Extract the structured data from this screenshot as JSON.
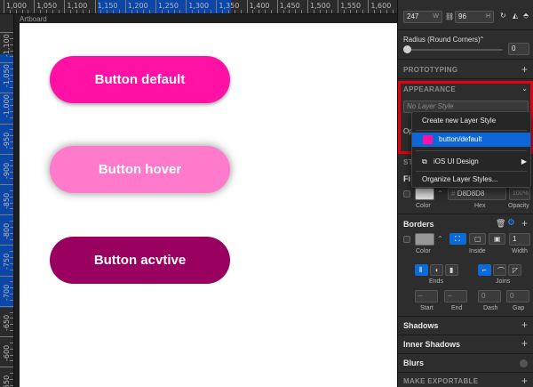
{
  "rulers": {
    "top": [
      "1,000",
      "1,050",
      "1,100",
      "1,150",
      "1,200",
      "1,250",
      "1,300",
      "1,350",
      "1,400",
      "1,450",
      "1,500",
      "1,550",
      "1,600"
    ],
    "left": [
      "-1,100",
      "-1,050",
      "-1,000",
      "-950",
      "-900",
      "-850",
      "-800",
      "-750",
      "-700",
      "-650",
      "-600",
      "-550"
    ]
  },
  "artboard": {
    "label": "Artboard",
    "buttons": [
      {
        "label": "Button default",
        "color": "#ff11a6"
      },
      {
        "label": "Button hover",
        "color": "#ff7acb"
      },
      {
        "label": "Button acvtive",
        "color": "#990060"
      }
    ]
  },
  "inspector": {
    "size": {
      "width": "247",
      "width_label": "W",
      "height": "96",
      "height_label": "H"
    },
    "radius": {
      "label": "Radius (Round Corners)",
      "value": "0"
    },
    "prototyping": {
      "label": "PROTOTYPING"
    },
    "appearance": {
      "label": "APPEARANCE",
      "layer_style_placeholder": "No Layer Style",
      "opacity_label_partial": "Op",
      "style_label_partial": "ST"
    },
    "layer_style_menu": {
      "create": "Create new Layer Style",
      "selected": "button/default",
      "selected_color": "#ff11a6",
      "library": "iOS UI Design",
      "organize": "Organize Layer Styles..."
    },
    "fills": {
      "label_partial": "Fi",
      "hex": "D8D8D8",
      "opacity": "100%",
      "color_label": "Color",
      "hex_label": "Hex",
      "opacity_label": "Opacity"
    },
    "borders": {
      "label": "Borders",
      "width": "1",
      "color_label": "Color",
      "position_label": "Inside",
      "width_label": "Width",
      "ends_label": "Ends",
      "joins_label": "Joins",
      "start_label": "Start",
      "end_label": "End",
      "dash_label": "Dash",
      "gap_label": "Gap",
      "dash_value": "0",
      "gap_value": "0"
    },
    "shadows": {
      "label": "Shadows"
    },
    "inner_shadows": {
      "label": "Inner Shadows"
    },
    "blurs": {
      "label": "Blurs"
    },
    "export": {
      "label": "MAKE EXPORTABLE"
    }
  }
}
